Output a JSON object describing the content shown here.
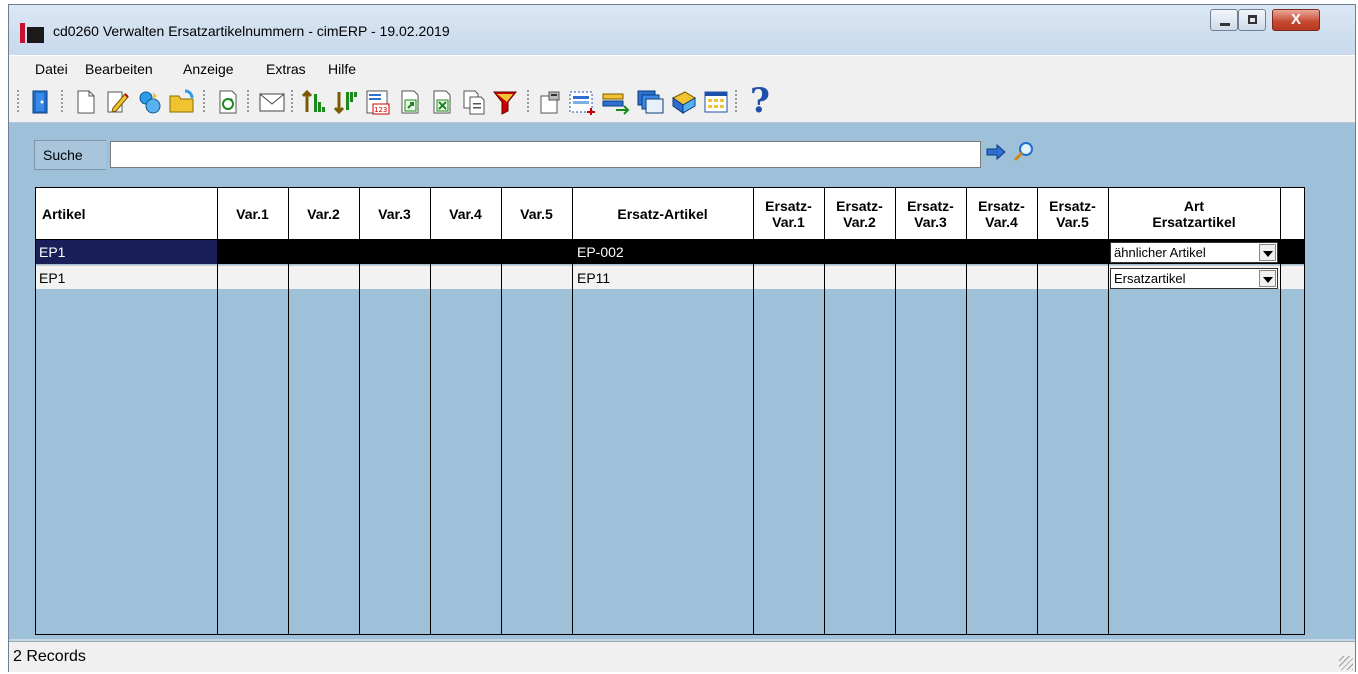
{
  "window": {
    "title": "cd0260 Verwalten Ersatzartikelnummern - cimERP - 19.02.2019",
    "close_glyph": "X"
  },
  "menu": [
    {
      "label": "Datei"
    },
    {
      "label": "Bearbeiten"
    },
    {
      "label": "Anzeige"
    },
    {
      "label": "Extras"
    },
    {
      "label": "Hilfe"
    }
  ],
  "toolbar": {
    "icons": [
      "exit-icon",
      "new-doc-icon",
      "edit-icon",
      "copy-record-icon",
      "open-folder-icon",
      "refresh-icon",
      "mail-icon",
      "sort-ascending-icon",
      "sort-descending-icon",
      "calendar-123-icon",
      "export-icon",
      "excel-icon",
      "copy-icon",
      "filter-icon",
      "properties-icon",
      "calendar-add-icon",
      "transfer-icon",
      "windows-icon",
      "book-icon",
      "grid-icon",
      "help-icon"
    ],
    "help_glyph": "?"
  },
  "search": {
    "label": "Suche",
    "value": "",
    "placeholder": ""
  },
  "grid": {
    "headers": {
      "artikel": "Artikel",
      "var1": "Var.1",
      "var2": "Var.2",
      "var3": "Var.3",
      "var4": "Var.4",
      "var5": "Var.5",
      "ersatz_artikel": "Ersatz-Artikel",
      "ersatz_var1_a": "Ersatz-",
      "ersatz_var1_b": "Var.1",
      "ersatz_var2_a": "Ersatz-",
      "ersatz_var2_b": "Var.2",
      "ersatz_var3_a": "Ersatz-",
      "ersatz_var3_b": "Var.3",
      "ersatz_var4_a": "Ersatz-",
      "ersatz_var4_b": "Var.4",
      "ersatz_var5_a": "Ersatz-",
      "ersatz_var5_b": "Var.5",
      "art_a": "Art",
      "art_b": "Ersatzartikel"
    },
    "rows": [
      {
        "artikel": "EP1",
        "ersatz_artikel": "EP-002",
        "art": "ähnlicher Artikel",
        "selected": true
      },
      {
        "artikel": "EP1",
        "ersatz_artikel": "EP11",
        "art": "Ersatzartikel",
        "selected": false
      }
    ]
  },
  "status": {
    "text": "2 Records"
  },
  "colors": {
    "background": "#9fc0d9",
    "selected_row": "#000000",
    "focus_cell": "#1a1f5a",
    "close_button": "#c4472e"
  }
}
